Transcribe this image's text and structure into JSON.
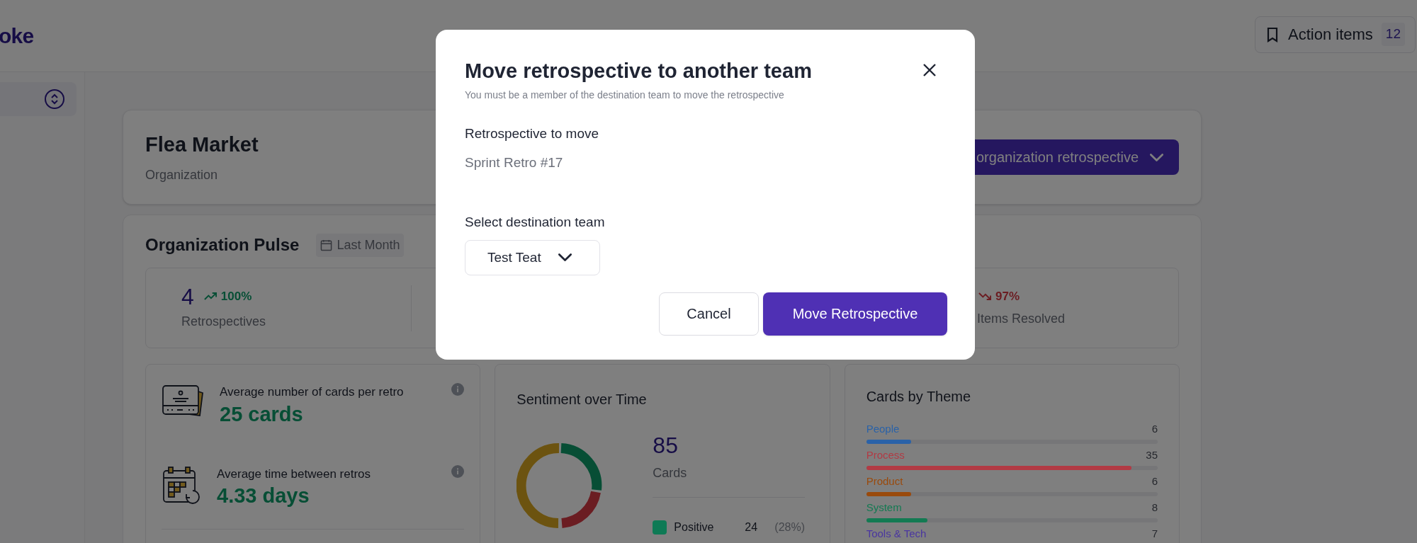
{
  "header": {
    "logo": "oke",
    "action_items": {
      "label": "Action items",
      "count": "12"
    }
  },
  "org": {
    "name": "Flea Market",
    "type": "Organization",
    "create_button": "organization retrospective"
  },
  "pulse": {
    "title": "Organization Pulse",
    "period": "Last Month",
    "stats": [
      {
        "value": "4",
        "change": "100%",
        "kind": "up",
        "label": "Retrospectives"
      },
      {
        "change": "97%",
        "kind": "down",
        "label": "Items Resolved"
      }
    ]
  },
  "metrics": [
    {
      "kind": "cards",
      "label": "Average number of cards per retro",
      "value": "25 cards"
    },
    {
      "kind": "calendar",
      "label": "Average time between retros",
      "value": "4.33 days"
    }
  ],
  "sentiment": {
    "title": "Sentiment over Time",
    "total": "85",
    "total_label": "Cards",
    "legend": [
      {
        "label": "Positive",
        "count": "24",
        "percent": "(28%)",
        "color": "#0e7a55"
      }
    ]
  },
  "themes": {
    "title": "Cards by Theme",
    "items": [
      {
        "label": "People",
        "count": "6",
        "level": 0.155,
        "color": "#2a62a8"
      },
      {
        "label": "Process",
        "count": "35",
        "level": 0.91,
        "color": "#b23a44"
      },
      {
        "label": "Product",
        "count": "6",
        "level": 0.155,
        "color": "#9a4a0c"
      },
      {
        "label": "System",
        "count": "8",
        "level": 0.21,
        "color": "#137a52"
      },
      {
        "label": "Tools & Tech",
        "count": "7",
        "color": "#4a36a0"
      }
    ]
  },
  "modal": {
    "title": "Move retrospective to another team",
    "subtitle": "You must be a member of the destination team to move the retrospective",
    "retro_label": "Retrospective to move",
    "retro_name": "Sprint Retro #17",
    "team_label": "Select destination team",
    "team_value": "Test Teat",
    "buttons": [
      {
        "kind": "secondary",
        "label": "Cancel"
      },
      {
        "kind": "primary",
        "label": "Move Retrospective"
      }
    ]
  }
}
